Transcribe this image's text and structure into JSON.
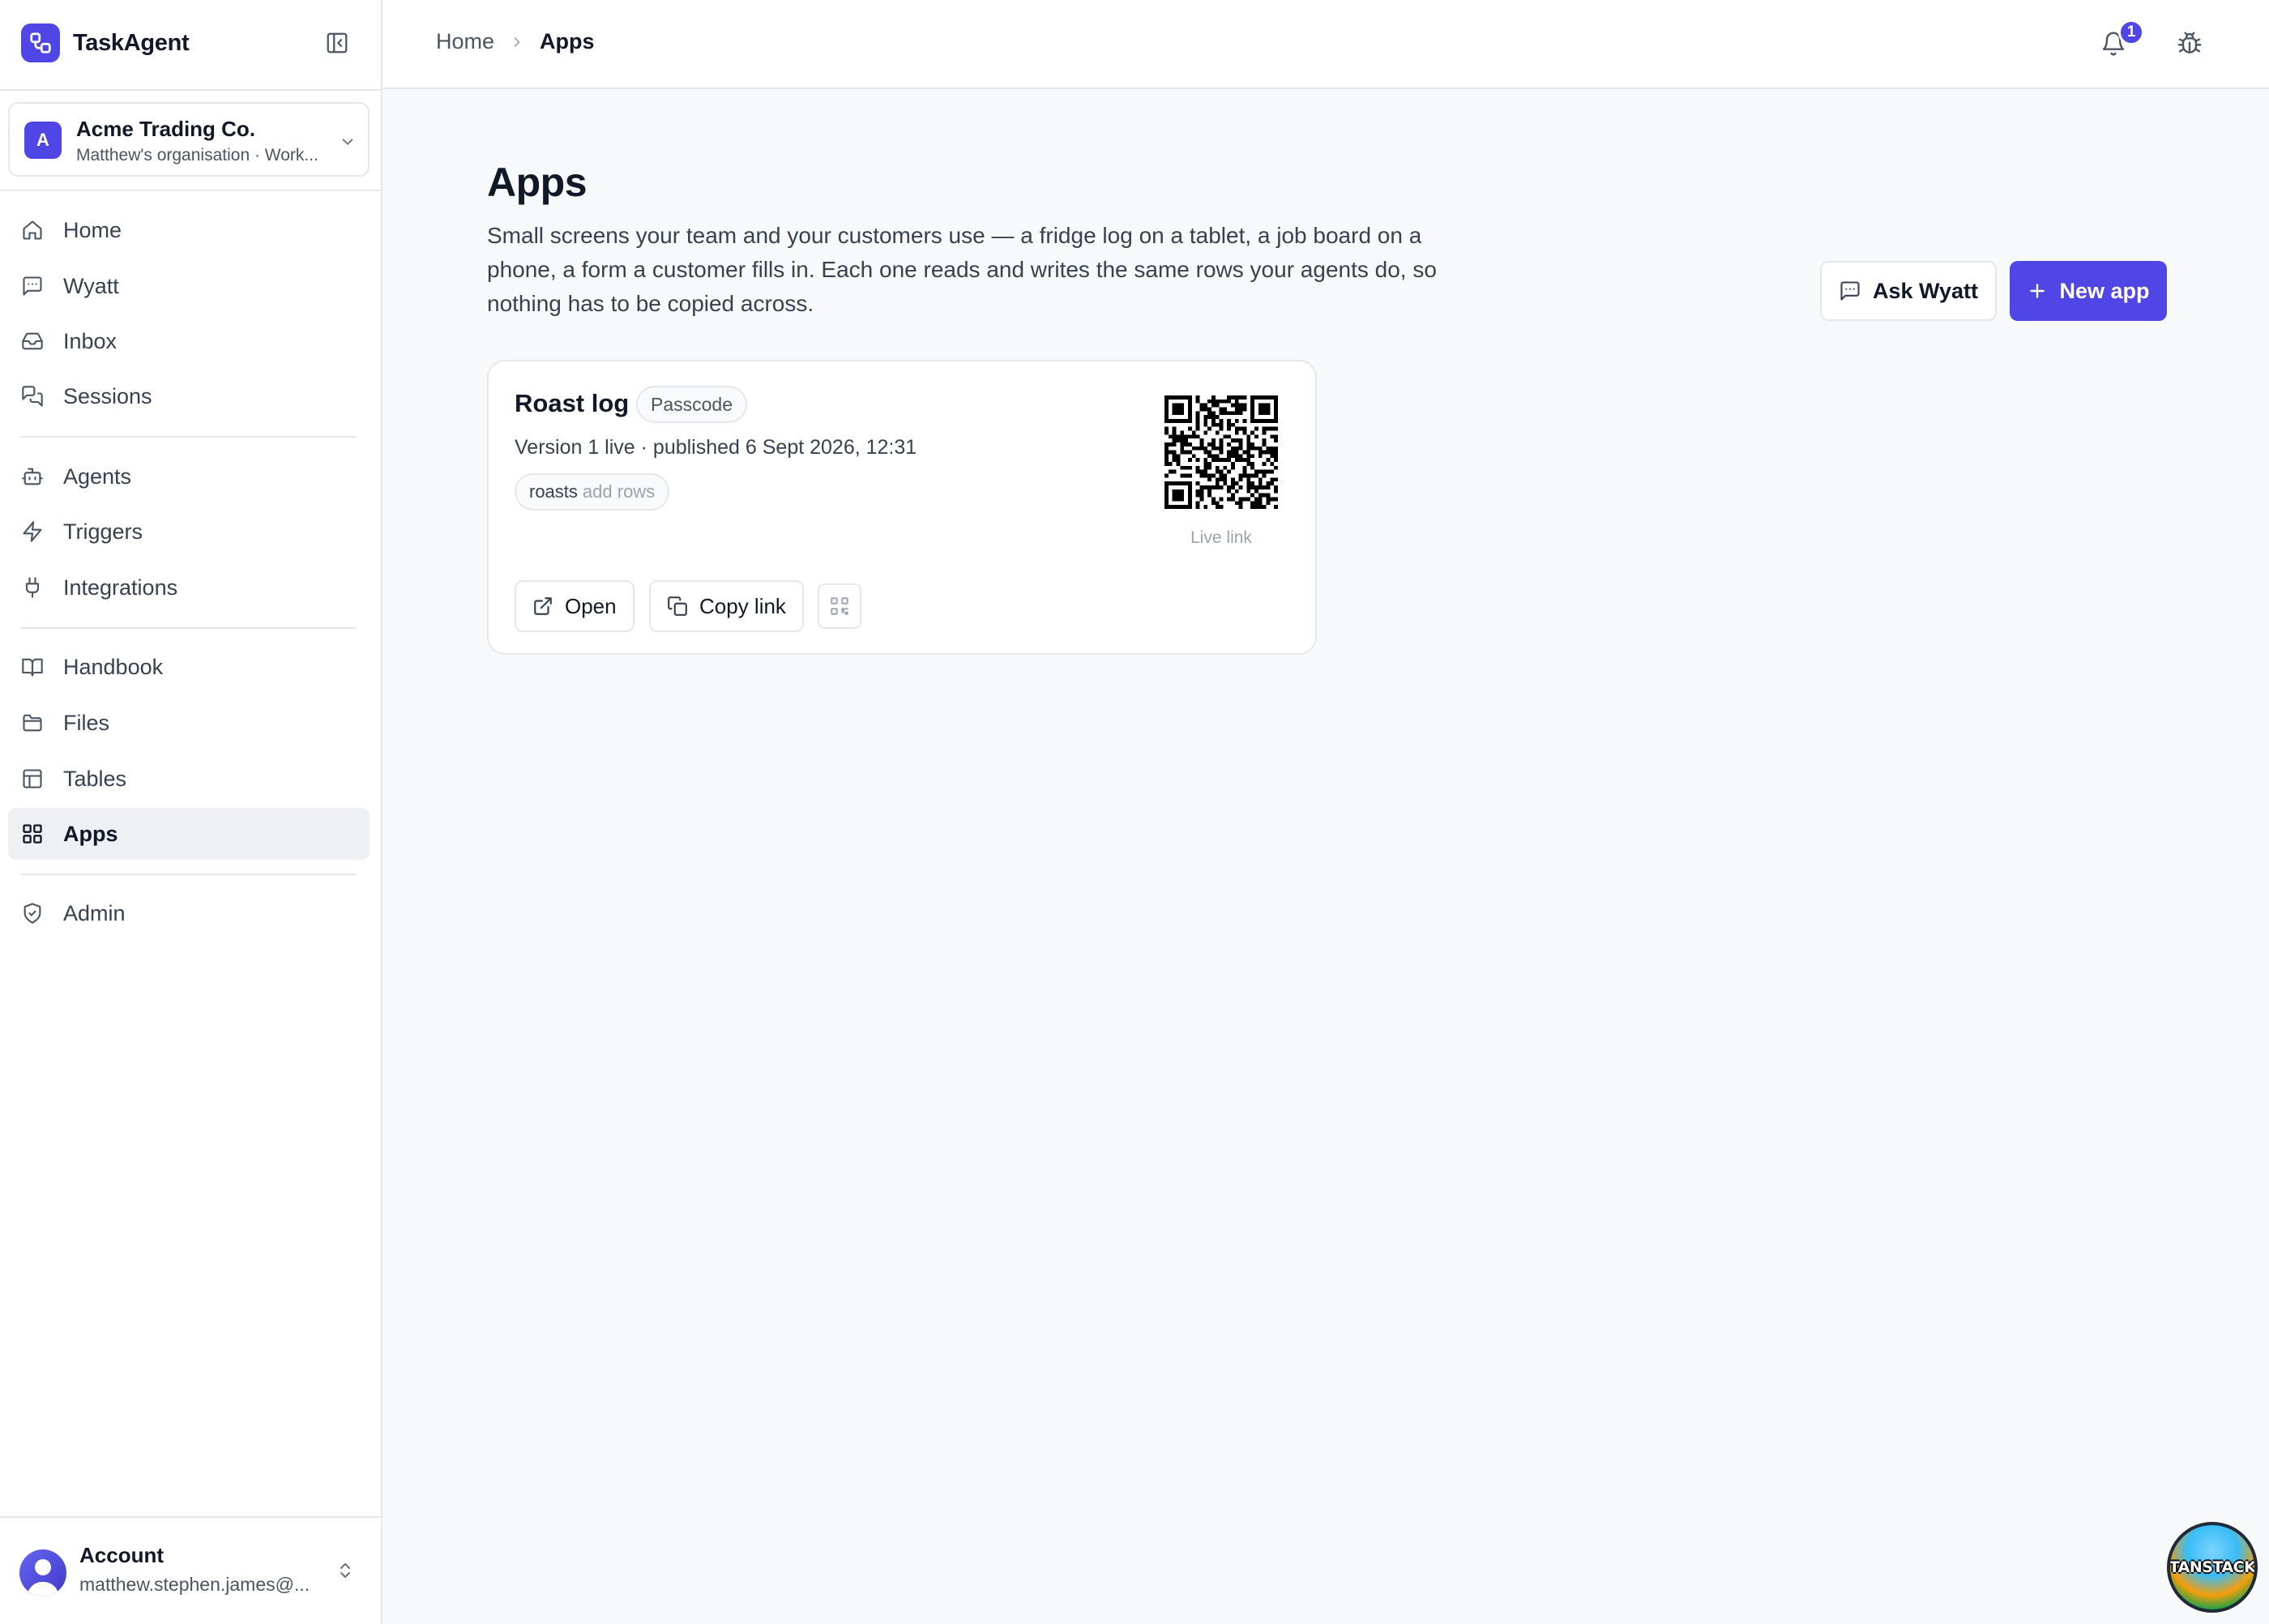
{
  "app": {
    "name": "TaskAgent"
  },
  "org": {
    "initial": "A",
    "name": "Acme Trading Co.",
    "subtitle": "Matthew's organisation · Work..."
  },
  "nav": {
    "home": "Home",
    "wyatt": "Wyatt",
    "inbox": "Inbox",
    "sessions": "Sessions",
    "agents": "Agents",
    "triggers": "Triggers",
    "integrations": "Integrations",
    "handbook": "Handbook",
    "files": "Files",
    "tables": "Tables",
    "apps": "Apps",
    "admin": "Admin",
    "active": "apps"
  },
  "account": {
    "label": "Account",
    "email": "matthew.stephen.james@..."
  },
  "header": {
    "breadcrumb": [
      "Home",
      "Apps"
    ],
    "notification_count": "1"
  },
  "main": {
    "title": "Apps",
    "description": "Small screens your team and your customers use — a fridge log on a tablet, a job board on a phone, a form a customer fills in. Each one reads and writes the same rows your agents do, so nothing has to be copied across.",
    "ask_button": "Ask Wyatt",
    "new_button": "New app"
  },
  "apps": [
    {
      "name": "Roast log",
      "access": "Passcode",
      "meta": "Version 1 live · published 6 Sept 2026, 12:31",
      "table": "roasts",
      "permission": "add rows",
      "qr_caption": "Live link",
      "open_label": "Open",
      "copy_label": "Copy link"
    }
  ],
  "devtools": {
    "label": "TANSTACK"
  },
  "colors": {
    "accent": "#4f46e5",
    "sidebar_bg": "#ffffff",
    "page_bg": "#f8f9fb",
    "border": "#e5e7eb",
    "active_nav_bg": "#eef0f4"
  }
}
